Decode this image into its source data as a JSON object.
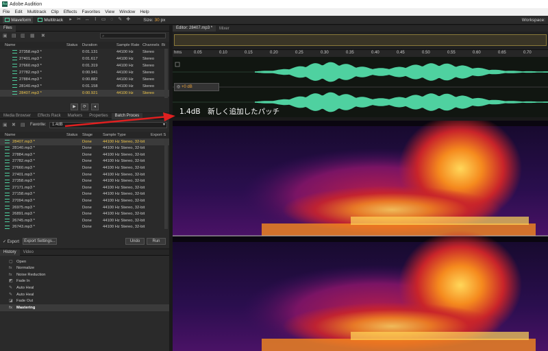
{
  "app": {
    "title": "Adobe Audition",
    "icon": "Au"
  },
  "menu": [
    "File",
    "Edit",
    "Multitrack",
    "Clip",
    "Effects",
    "Favorites",
    "View",
    "Window",
    "Help"
  ],
  "toolbar": {
    "waveform": "Waveform",
    "multitrack": "Multitrack",
    "size_label": "Size:",
    "size_value": "30",
    "size_unit": "px",
    "workspace": "Workspace:"
  },
  "files": {
    "tab": "Files",
    "columns": [
      "Name",
      "Status",
      "Duration",
      "Sample Rate",
      "Channels",
      "Bi"
    ],
    "rows": [
      [
        "27358.mp3 *",
        "",
        "0:01.131",
        "44100 Hz",
        "Stereo"
      ],
      [
        "27401.mp3 *",
        "",
        "0:01.617",
        "44100 Hz",
        "Stereo"
      ],
      [
        "27660.mp3 *",
        "",
        "0:01.319",
        "44100 Hz",
        "Stereo"
      ],
      [
        "27782.mp3 *",
        "",
        "0:00.941",
        "44100 Hz",
        "Stereo"
      ],
      [
        "27884.mp3 *",
        "",
        "0:00.882",
        "44100 Hz",
        "Stereo"
      ],
      [
        "28140.mp3 *",
        "",
        "0:01.158",
        "44100 Hz",
        "Stereo"
      ],
      [
        "28407.mp3 *",
        "",
        "0:00.921",
        "44100 Hz",
        "Stereo"
      ]
    ]
  },
  "batch": {
    "tabs": [
      "Media Browser",
      "Effects Rack",
      "Markers",
      "Properties",
      "Batch Proces"
    ],
    "favorite_label": "Favorite:",
    "favorite_value": "1.4dB",
    "columns": [
      "Name",
      "Status",
      "Stage",
      "Sample Type",
      "Export S"
    ],
    "rows": [
      [
        "28407.mp3 *",
        "",
        "Done",
        "44100 Hz Stereo, 32-bit"
      ],
      [
        "28140.mp3 *",
        "",
        "Done",
        "44100 Hz Stereo, 32-bit"
      ],
      [
        "27884.mp3 *",
        "",
        "Done",
        "44100 Hz Stereo, 32-bit"
      ],
      [
        "27782.mp3 *",
        "",
        "Done",
        "44100 Hz Stereo, 32-bit"
      ],
      [
        "27660.mp3 *",
        "",
        "Done",
        "44100 Hz Stereo, 32-bit"
      ],
      [
        "27401.mp3 *",
        "",
        "Done",
        "44100 Hz Stereo, 32-bit"
      ],
      [
        "27358.mp3 *",
        "",
        "Done",
        "44100 Hz Stereo, 32-bit"
      ],
      [
        "27171.mp3 *",
        "",
        "Done",
        "44100 Hz Stereo, 32-bit"
      ],
      [
        "27158.mp3 *",
        "",
        "Done",
        "44100 Hz Stereo, 32-bit"
      ],
      [
        "27094.mp3 *",
        "",
        "Done",
        "44100 Hz Stereo, 32-bit"
      ],
      [
        "26975.mp3 *",
        "",
        "Done",
        "44100 Hz Stereo, 32-bit"
      ],
      [
        "26891.mp3 *",
        "",
        "Done",
        "44100 Hz Stereo, 32-bit"
      ],
      [
        "26745.mp3 *",
        "",
        "Done",
        "44100 Hz Stereo, 32-bit"
      ],
      [
        "26743.mp3 *",
        "",
        "Done",
        "44100 Hz Stereo, 32-bit"
      ]
    ],
    "export_label": "Export",
    "export_settings": "Export Settings...",
    "undo": "Undo",
    "run": "Run"
  },
  "history": {
    "tabs": [
      "History",
      "Video"
    ],
    "items": [
      "Open",
      "Normalize",
      "Noise Reduction",
      "Fade In",
      "Auto Heal",
      "Auto Heal",
      "Fade Out",
      "Mastering"
    ]
  },
  "editor": {
    "tab": "Editor: 28407.mp3 *",
    "mixer_tab": "Mixer",
    "ruler": [
      "hms",
      "0.05",
      "0.10",
      "0.15",
      "0.20",
      "0.25",
      "0.30",
      "0.35",
      "0.40",
      "0.45",
      "0.50",
      "0.55",
      "0.60",
      "0.65",
      "0.70"
    ],
    "gain": "+0 dB"
  },
  "annotation": "1.4dB　新しく追加したパッチ",
  "colors": {
    "accent": "#4fd1a0",
    "highlight": "#e8a23a",
    "arrow": "#e02020"
  }
}
